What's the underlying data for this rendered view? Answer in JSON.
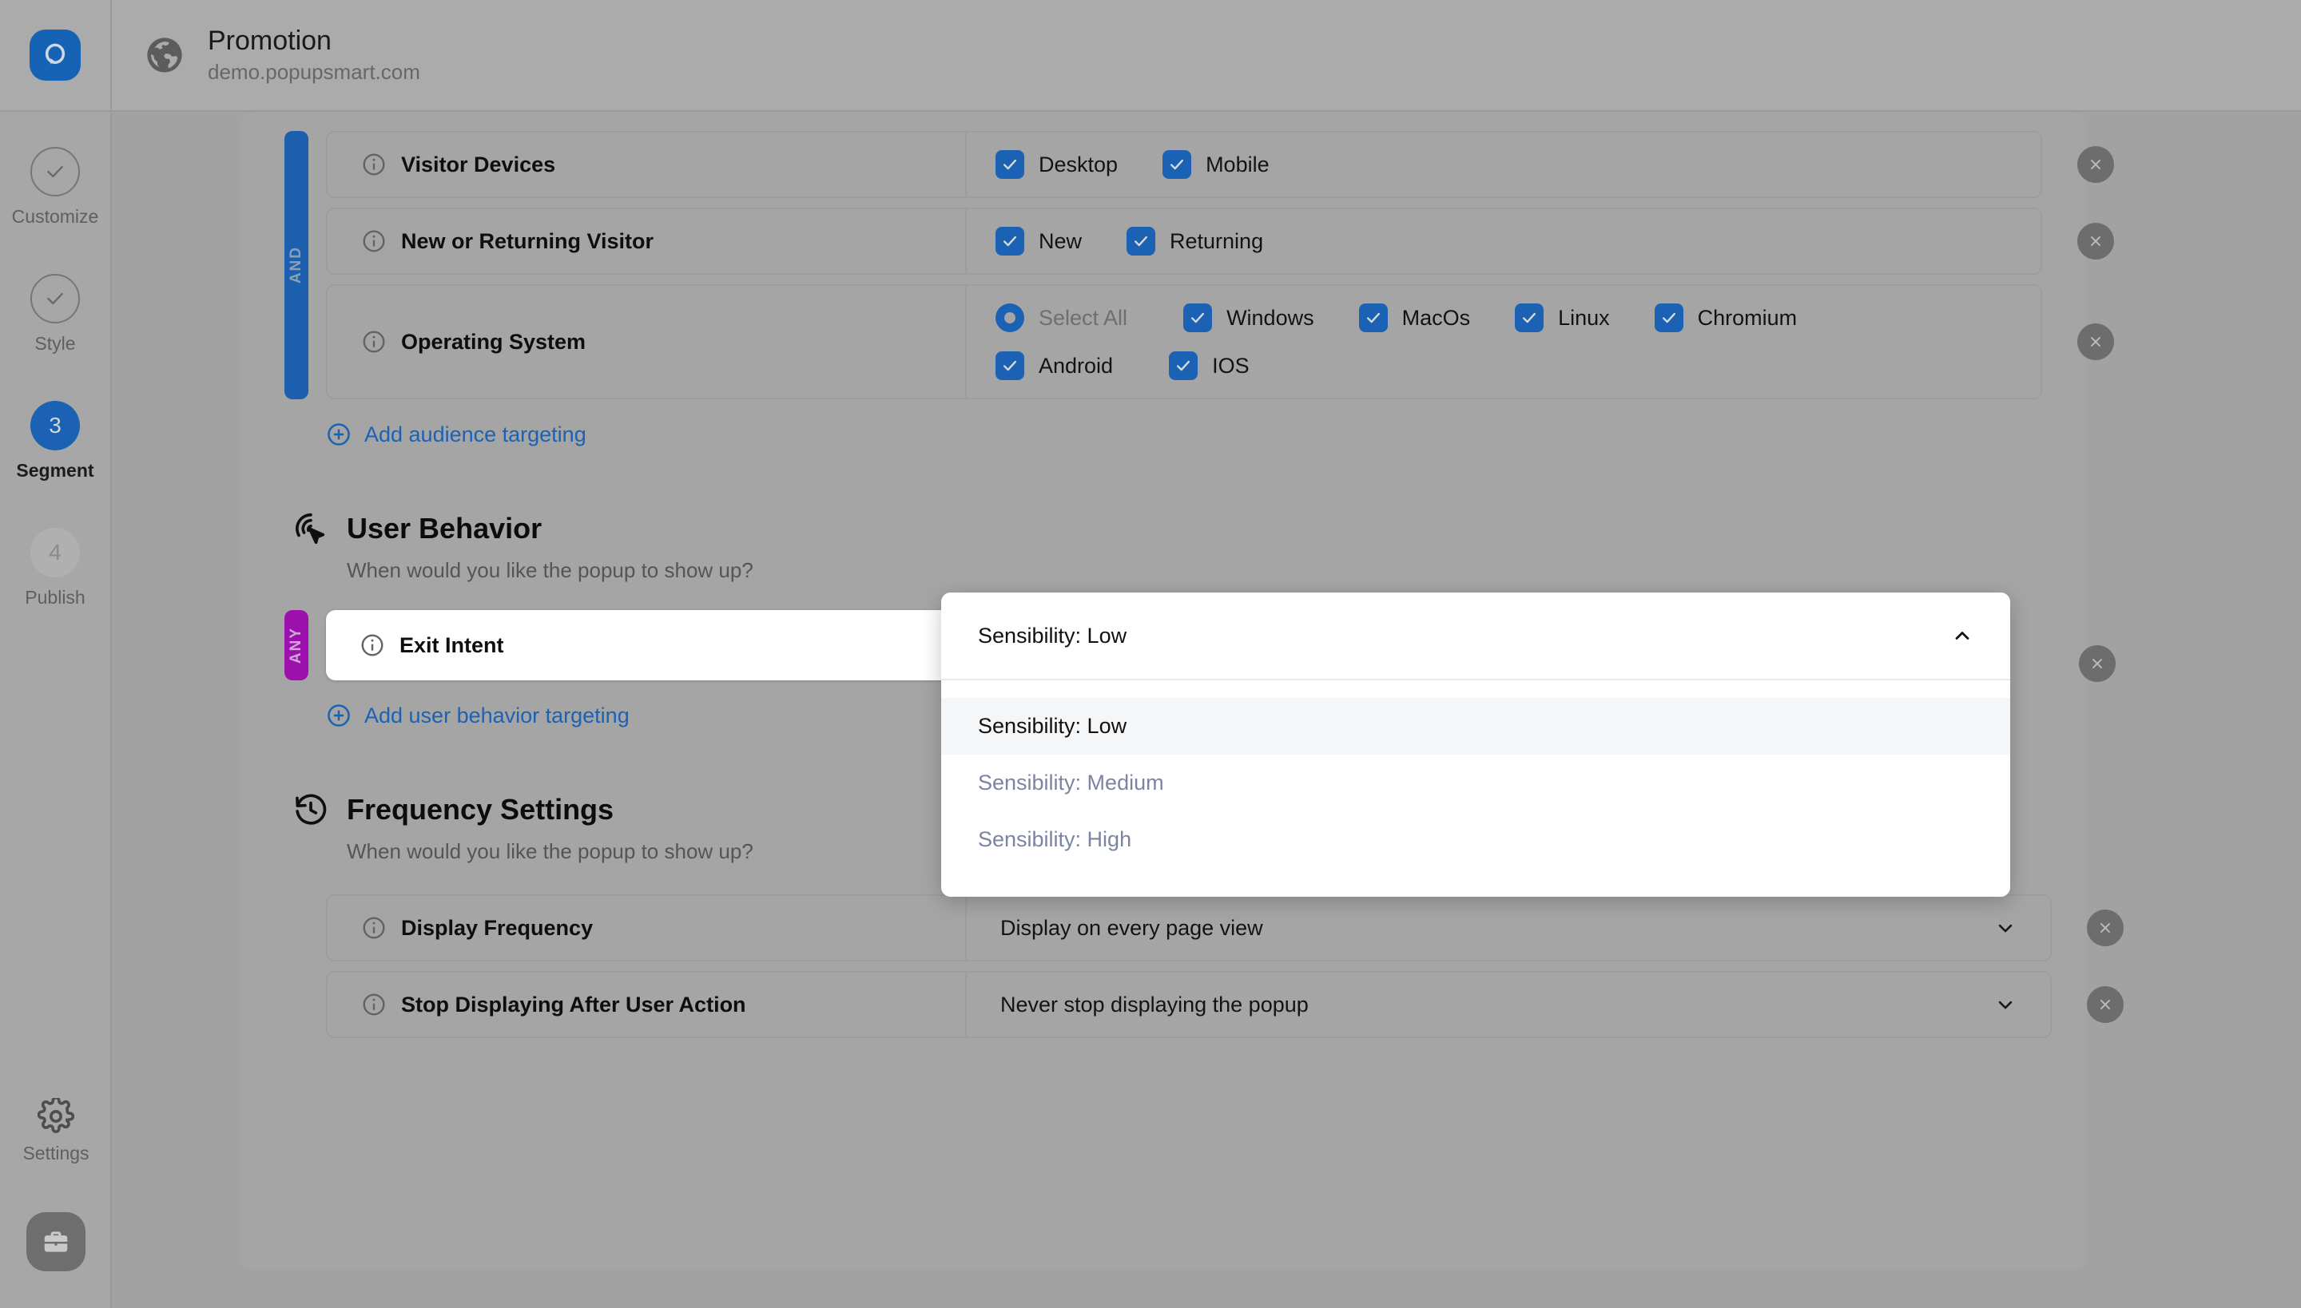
{
  "topbar": {
    "logo_icon": "popupsmart-logo-icon",
    "globe_icon": "globe-icon",
    "title": "Promotion",
    "url": "demo.popupsmart.com"
  },
  "rail": {
    "steps": [
      {
        "badge": "✓",
        "label": "Customize",
        "state": "done"
      },
      {
        "badge": "✓",
        "label": "Style",
        "state": "done"
      },
      {
        "badge": "3",
        "label": "Segment",
        "state": "active"
      },
      {
        "badge": "4",
        "label": "Publish",
        "state": "idle"
      }
    ],
    "settings_label": "Settings",
    "settings_icon": "gear-icon",
    "briefcase_icon": "briefcase-icon"
  },
  "audience": {
    "connector": "AND",
    "rules": [
      {
        "label": "Visitor Devices",
        "options": [
          {
            "label": "Desktop",
            "type": "checkbox",
            "checked": true
          },
          {
            "label": "Mobile",
            "type": "checkbox",
            "checked": true
          }
        ]
      },
      {
        "label": "New or Returning Visitor",
        "options": [
          {
            "label": "New",
            "type": "checkbox",
            "checked": true
          },
          {
            "label": "Returning",
            "type": "checkbox",
            "checked": true
          }
        ]
      },
      {
        "label": "Operating System",
        "options_row1": [
          {
            "label": "Select All",
            "type": "radio",
            "checked": true
          },
          {
            "label": "Windows",
            "type": "checkbox",
            "checked": true
          },
          {
            "label": "MacOs",
            "type": "checkbox",
            "checked": true
          },
          {
            "label": "Linux",
            "type": "checkbox",
            "checked": true
          },
          {
            "label": "Chromium",
            "type": "checkbox",
            "checked": true
          }
        ],
        "options_row2": [
          {
            "label": "Android",
            "type": "checkbox",
            "checked": true
          },
          {
            "label": "IOS",
            "type": "checkbox",
            "checked": true
          }
        ]
      }
    ],
    "add_link": "Add audience targeting",
    "remove_icon": "close-icon"
  },
  "user_behavior": {
    "icon": "cursor-target-icon",
    "title": "User Behavior",
    "subtitle": "When would you like the popup to show up?",
    "connector": "ANY",
    "rule_label": "Exit Intent",
    "dropdown": {
      "selected": "Sensibility: Low",
      "caret_icon": "chevron-up-icon",
      "open": true,
      "options": [
        "Sensibility: Low",
        "Sensibility: Medium",
        "Sensibility: High"
      ]
    },
    "add_link": "Add user behavior targeting"
  },
  "frequency": {
    "icon": "history-clock-icon",
    "title": "Frequency Settings",
    "subtitle": "When would you like the popup to show up?",
    "rows": [
      {
        "label": "Display Frequency",
        "value": "Display on every page view",
        "caret_icon": "chevron-down-icon"
      },
      {
        "label": "Stop Displaying After User Action",
        "value": "Never stop displaying the popup",
        "caret_icon": "chevron-down-icon"
      }
    ]
  },
  "colors": {
    "accent_blue": "#1b62b4",
    "accent_purple": "#9c11ad",
    "link_blue": "#1b62b4",
    "page_bg": "#a2a2a2",
    "card_bg": "#a5a5a5"
  }
}
